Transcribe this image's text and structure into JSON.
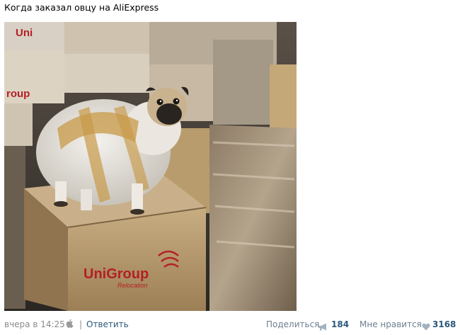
{
  "post": {
    "text": "Когда заказал овцу на AliExpress",
    "photo_box_brand": "UniGroup",
    "photo_box_sub": "Relocation"
  },
  "footer": {
    "date": "вчера в 14:25",
    "device_icon": "apple-icon",
    "separator": "|",
    "reply_label": "Ответить",
    "share_label": "Поделиться",
    "share_count": "184",
    "share_icon": "megaphone-icon",
    "like_label": "Мне нравится",
    "like_count": "3168",
    "like_icon": "heart-icon"
  },
  "colors": {
    "link": "#2b587a",
    "muted": "#8a8a8a",
    "brand_red": "#b32025"
  }
}
